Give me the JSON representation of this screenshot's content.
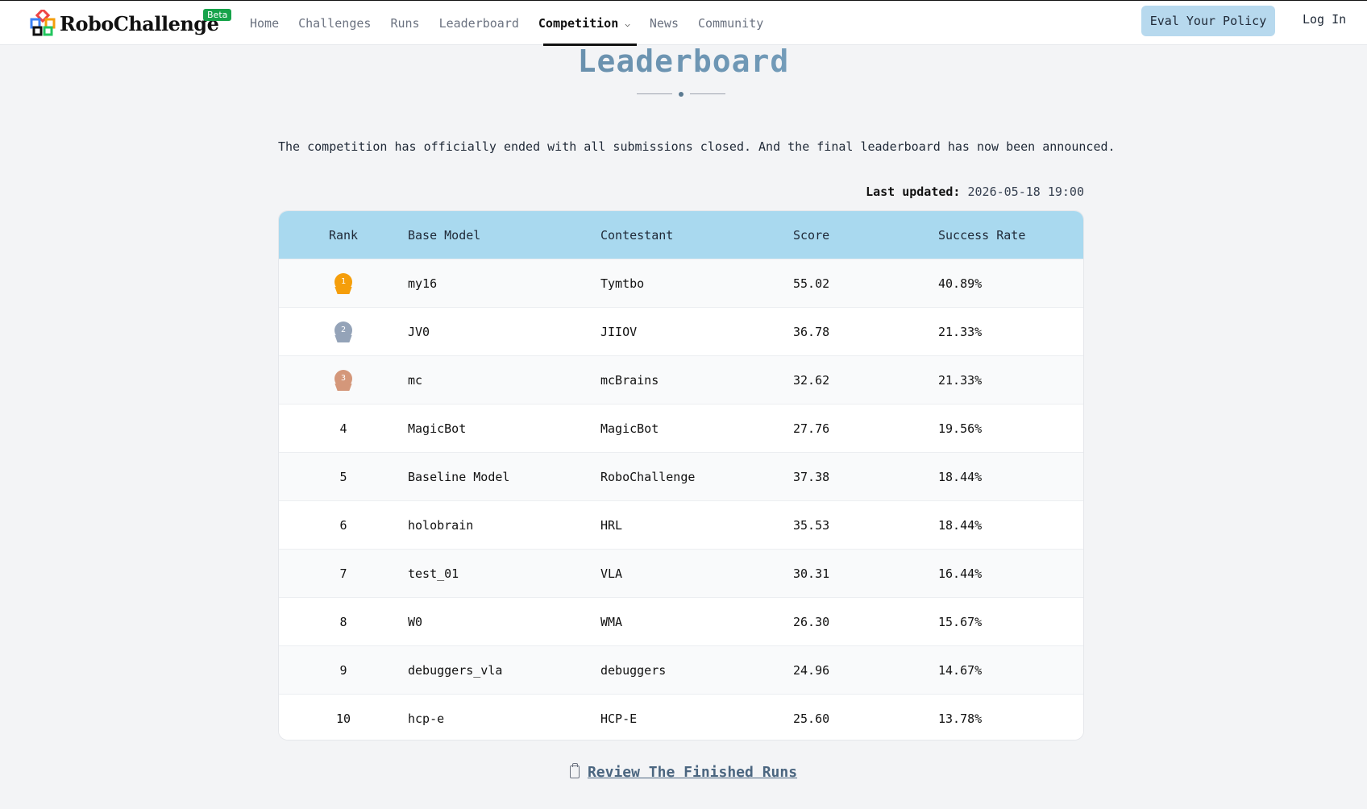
{
  "brand": {
    "name": "RoboChallenge",
    "badge": "Beta",
    "colors": [
      "#ef4444",
      "#f59e0b",
      "#3b82f6",
      "#22c55e"
    ]
  },
  "nav": {
    "items": [
      {
        "label": "Home",
        "active": false
      },
      {
        "label": "Challenges",
        "active": false
      },
      {
        "label": "Runs",
        "active": false
      },
      {
        "label": "Leaderboard",
        "active": false
      },
      {
        "label": "Competition",
        "active": true,
        "icon": "chevron-down-icon"
      },
      {
        "label": "News",
        "active": false
      },
      {
        "label": "Community",
        "active": false
      }
    ],
    "eval_button": "Eval Your Policy",
    "login": "Log In"
  },
  "page": {
    "title": "Leaderboard",
    "notice": "The competition has officially ended with all submissions closed. And the final leaderboard has now been announced.",
    "updated_label": "Last updated:",
    "updated_value": "2026-05-18 19:00"
  },
  "table": {
    "headers": [
      "Rank",
      "Base Model",
      "Contestant",
      "Score",
      "Success Rate"
    ],
    "rows": [
      {
        "rank": "1",
        "medal": "gold",
        "model": "my16",
        "contestant": "Tymtbo",
        "score": "55.02",
        "success": "40.89%"
      },
      {
        "rank": "2",
        "medal": "silver",
        "model": "JV0",
        "contestant": "JIIOV",
        "score": "36.78",
        "success": "21.33%"
      },
      {
        "rank": "3",
        "medal": "bronze",
        "model": "mc",
        "contestant": "mcBrains",
        "score": "32.62",
        "success": "21.33%"
      },
      {
        "rank": "4",
        "medal": "",
        "model": "MagicBot",
        "contestant": "MagicBot",
        "score": "27.76",
        "success": "19.56%"
      },
      {
        "rank": "5",
        "medal": "",
        "model": "Baseline Model",
        "contestant": "RoboChallenge",
        "score": "37.38",
        "success": "18.44%"
      },
      {
        "rank": "6",
        "medal": "",
        "model": "holobrain",
        "contestant": "HRL",
        "score": "35.53",
        "success": "18.44%"
      },
      {
        "rank": "7",
        "medal": "",
        "model": "test_01",
        "contestant": "VLA",
        "score": "30.31",
        "success": "16.44%"
      },
      {
        "rank": "8",
        "medal": "",
        "model": "W0",
        "contestant": "WMA",
        "score": "26.30",
        "success": "15.67%"
      },
      {
        "rank": "9",
        "medal": "",
        "model": "debuggers_vla",
        "contestant": "debuggers",
        "score": "24.96",
        "success": "14.67%"
      },
      {
        "rank": "10",
        "medal": "",
        "model": "hcp-e",
        "contestant": "HCP-E",
        "score": "25.60",
        "success": "13.78%"
      }
    ],
    "medal_colors": {
      "gold": "#f59e0b",
      "silver": "#94a3b8",
      "bronze": "#d4977a"
    }
  },
  "footer": {
    "link": "Review The Finished Runs",
    "icon": "clipboard-icon"
  }
}
